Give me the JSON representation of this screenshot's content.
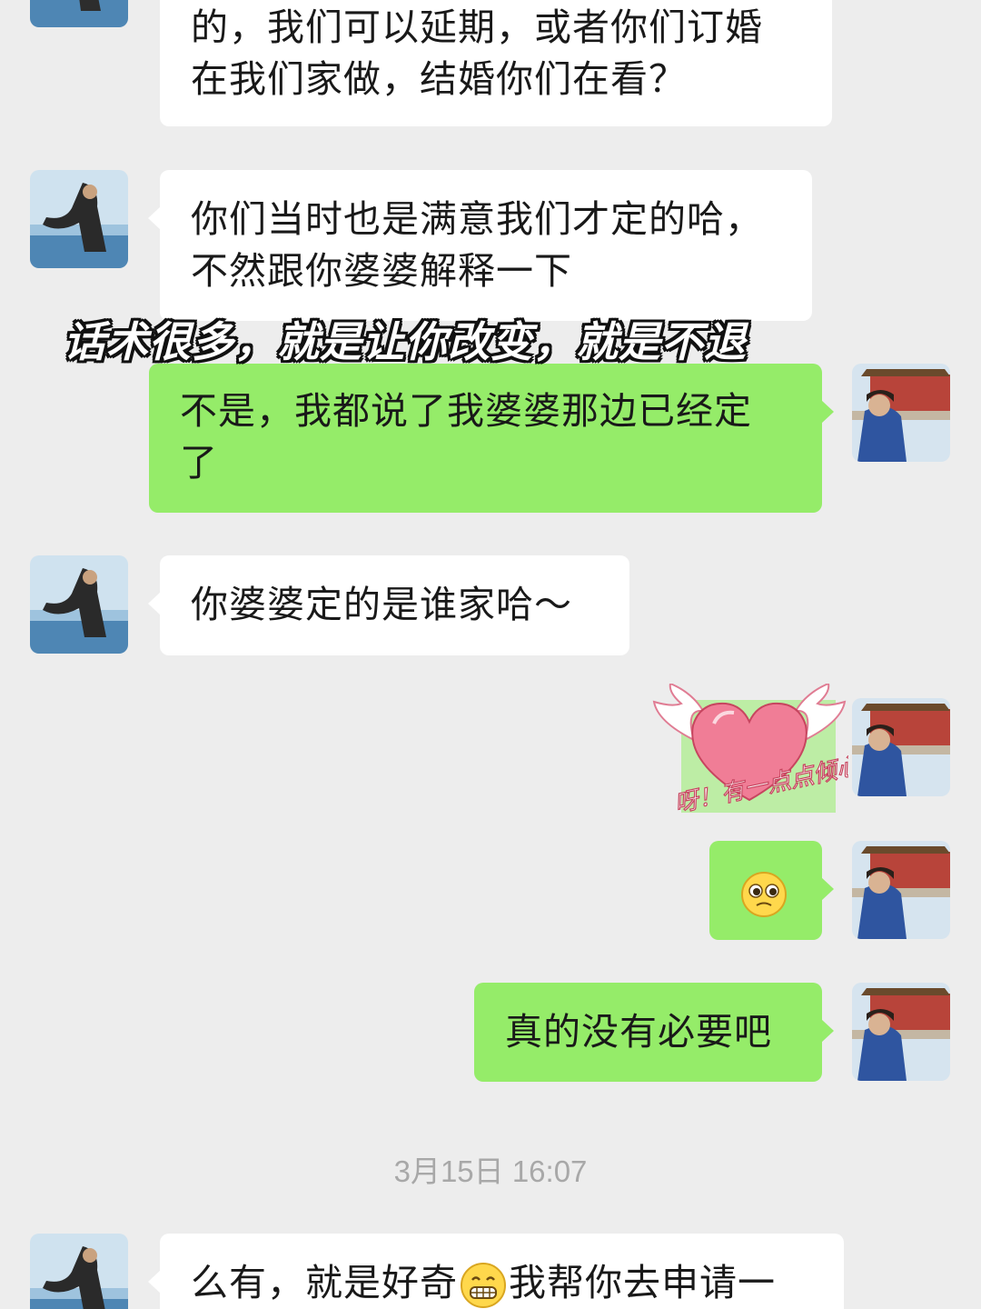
{
  "messages": [
    {
      "side": "in",
      "text_lines": [
        "的，我们可以延期，或者你们订婚",
        "在我们家做，结婚你们在看？"
      ]
    },
    {
      "side": "in",
      "text_lines": [
        "你们当时也是满意我们才定的哈，",
        "不然跟你婆婆解释一下"
      ]
    },
    {
      "side": "out",
      "text_lines": [
        "不是，我都说了我婆婆那边已经定",
        "了"
      ]
    },
    {
      "side": "in",
      "text_lines": [
        "你婆婆定的是谁家哈～"
      ]
    },
    {
      "side": "out",
      "sticker_text": "呀！有一点点倾心",
      "sticker_icon": "winged-heart-sticker"
    },
    {
      "side": "out",
      "emoji": "pleading-face-emoji"
    },
    {
      "side": "out",
      "text_lines": [
        "真的没有必要吧"
      ]
    },
    {
      "side": "in",
      "text_before": "么有，就是好奇",
      "emoji": "grinning-face-emoji",
      "text_after": "我帮你去申请一"
    }
  ],
  "overlay_caption": "话术很多，就是让你改变，就是不退",
  "timestamp": "3月15日 16:07",
  "colors": {
    "background": "#ededed",
    "incoming_bubble": "#ffffff",
    "outgoing_bubble": "#95ec69",
    "timestamp": "#a8a8a8"
  }
}
